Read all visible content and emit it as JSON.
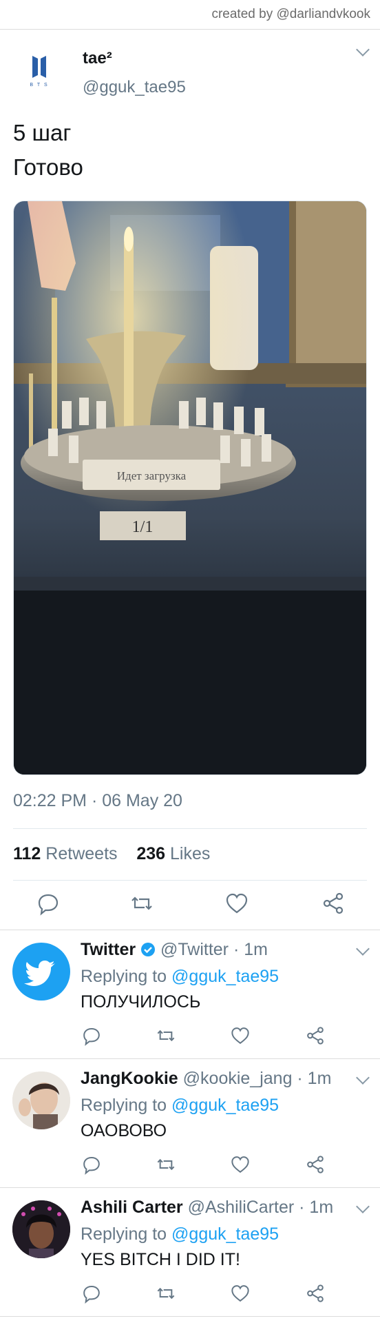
{
  "credit": "created by @darliandvkook",
  "tweet": {
    "name": "tae²",
    "handle": "@gguk_tae95",
    "text_line1": "5 шаг",
    "text_line2": "Готово",
    "photo": {
      "sign_text": "Идет загрузка",
      "counter_text": "1/1"
    },
    "timestamp": "02:22 PM · 06 May 20",
    "retweets_count": "112",
    "retweets_label": "Retweets",
    "likes_count": "236",
    "likes_label": "Likes"
  },
  "replies": [
    {
      "name": "Twitter",
      "verified": true,
      "meta": "@Twitter · 1m",
      "replying_prefix": "Replying to",
      "replying_handle": "@gguk_tae95",
      "text": "ПОЛУЧИЛОСЬ"
    },
    {
      "name": "JangKookie",
      "meta": "@kookie_jang · 1m",
      "replying_prefix": "Replying to",
      "replying_handle": "@gguk_tae95",
      "text": "ОАОВОВО"
    },
    {
      "name": "Ashili Carter",
      "meta": "@AshiliCarter · 1m",
      "replying_prefix": "Replying to",
      "replying_handle": "@gguk_tae95",
      "text": "YES BITCH I DID IT!"
    }
  ],
  "colors": {
    "link": "#1da1f2",
    "muted": "#657786",
    "text": "#14171a",
    "bts_logo": "#2a5fa8"
  },
  "icons": [
    "bts-logo-icon",
    "chevron-down-icon",
    "reply-icon",
    "retweet-icon",
    "like-icon",
    "share-icon",
    "twitter-bird-icon",
    "verified-badge-icon"
  ]
}
